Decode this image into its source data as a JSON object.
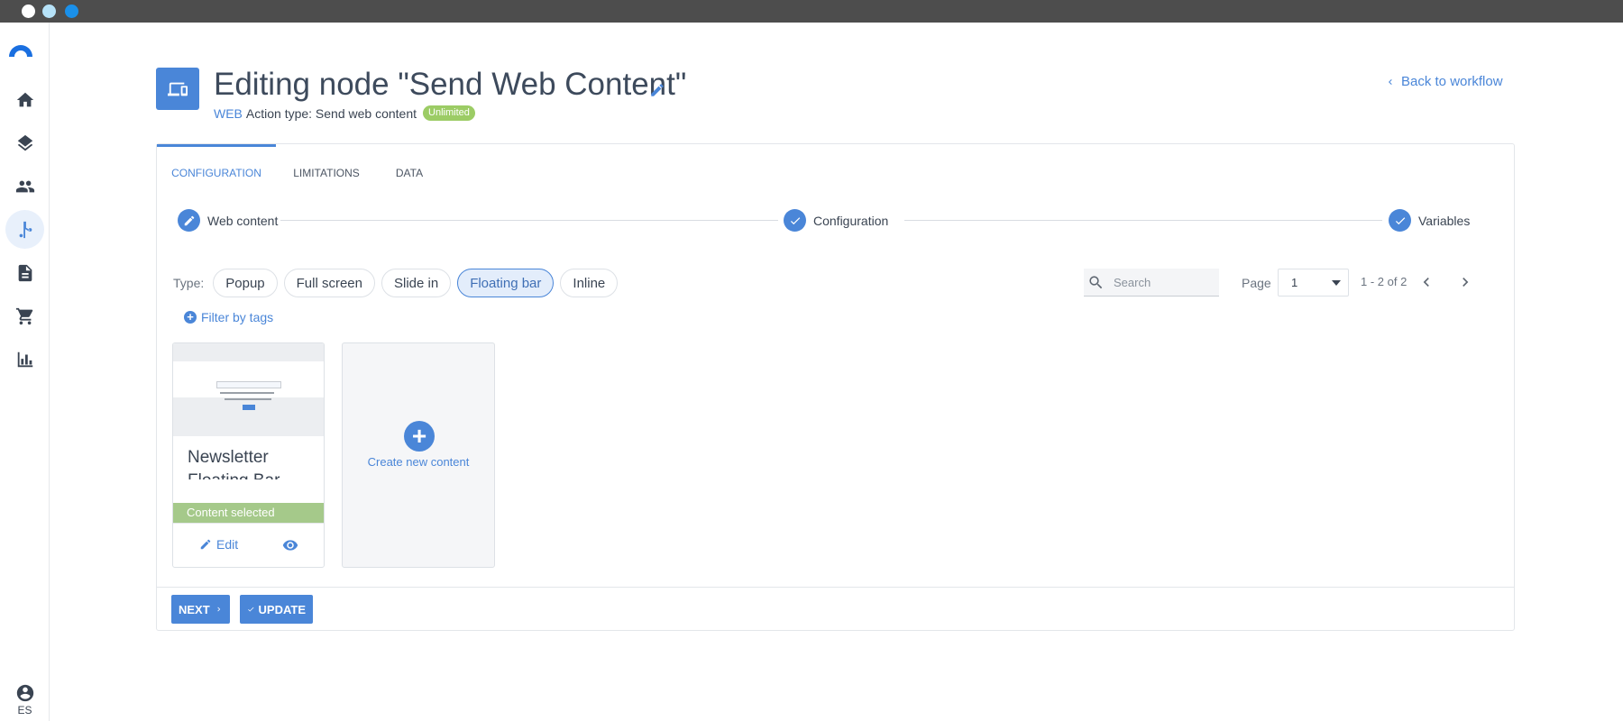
{
  "window": {
    "dot_colors": [
      "#ffffff",
      "#b6e2f8",
      "#1a90ea"
    ]
  },
  "sidebar": {
    "items": [
      {
        "name": "home-icon"
      },
      {
        "name": "layers-icon"
      },
      {
        "name": "people-icon"
      },
      {
        "name": "workflow-icon",
        "active": true
      },
      {
        "name": "document-icon"
      },
      {
        "name": "cart-icon"
      },
      {
        "name": "chart-icon"
      }
    ],
    "user_label": "ES"
  },
  "header": {
    "title": "Editing node \"Send Web Content\"",
    "channel": "WEB",
    "action_type": "Action type: Send web content",
    "badge": "Unlimited",
    "back_link": "Back to workflow"
  },
  "tabs": [
    {
      "label": "CONFIGURATION",
      "active": true
    },
    {
      "label": "LIMITATIONS"
    },
    {
      "label": "DATA"
    }
  ],
  "steps": [
    {
      "label": "Web content",
      "icon": "pencil-icon"
    },
    {
      "label": "Configuration",
      "icon": "check-icon"
    },
    {
      "label": "Variables",
      "icon": "check-icon"
    }
  ],
  "filters": {
    "type_label": "Type:",
    "types": [
      {
        "label": "Popup"
      },
      {
        "label": "Full screen"
      },
      {
        "label": "Slide in"
      },
      {
        "label": "Floating bar",
        "selected": true
      },
      {
        "label": "Inline"
      }
    ],
    "filter_tags": "Filter by tags"
  },
  "search": {
    "placeholder": "Search",
    "value": ""
  },
  "pagination": {
    "page_label": "Page",
    "page_value": "1",
    "range": "1 - 2 of 2"
  },
  "content_cards": [
    {
      "title": "Newsletter Floating Bar",
      "status": "Content selected",
      "edit_label": "Edit"
    }
  ],
  "create_card": {
    "label": "Create new content"
  },
  "buttons": {
    "next": "NEXT",
    "update": "UPDATE"
  },
  "colors": {
    "accent": "#4a86d8",
    "badge": "#9ccc65",
    "selected_bar": "#a5c98a",
    "titlebar": "#4d4d4d"
  }
}
